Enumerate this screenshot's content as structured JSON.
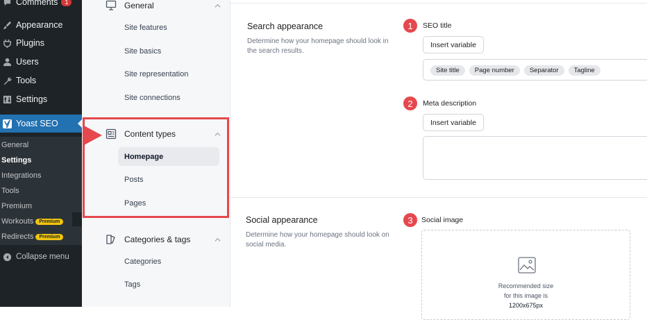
{
  "wp_menu": {
    "comments": {
      "label": "Comments",
      "count": "1"
    },
    "appearance": "Appearance",
    "plugins": "Plugins",
    "users": "Users",
    "tools": "Tools",
    "settings": "Settings",
    "yoast": "Yoast SEO",
    "yoast_sub": {
      "general": "General",
      "settings": "Settings",
      "integrations": "Integrations",
      "tools": "Tools",
      "premium": "Premium",
      "workouts": "Workouts",
      "redirects": "Redirects",
      "premium_badge": "Premium"
    },
    "collapse": "Collapse menu"
  },
  "settings_nav": {
    "general": {
      "label": "General",
      "items": [
        "Site features",
        "Site basics",
        "Site representation",
        "Site connections"
      ]
    },
    "content_types": {
      "label": "Content types",
      "items": [
        "Homepage",
        "Posts",
        "Pages"
      ]
    },
    "categories_tags": {
      "label": "Categories & tags",
      "items": [
        "Categories",
        "Tags"
      ]
    }
  },
  "main": {
    "search": {
      "title": "Search appearance",
      "description": "Determine how your homepage should look in the search results."
    },
    "seo_title": {
      "number": "1",
      "label": "SEO title",
      "insert_variable": "Insert variable",
      "chips": [
        "Site title",
        "Page number",
        "Separator",
        "Tagline"
      ]
    },
    "meta": {
      "number": "2",
      "label": "Meta description",
      "insert_variable": "Insert variable"
    },
    "social": {
      "title": "Social appearance",
      "description": "Determine how your homepage should look on social media."
    },
    "social_image": {
      "number": "3",
      "label": "Social image",
      "line1": "Recommended size",
      "line2": "for this image is",
      "line3": "1200x675px"
    }
  },
  "colors": {
    "wp_sidebar": "#1d2327",
    "wp_active": "#2271b1",
    "highlight": "#e5484d",
    "premium": "#f1c40f"
  }
}
